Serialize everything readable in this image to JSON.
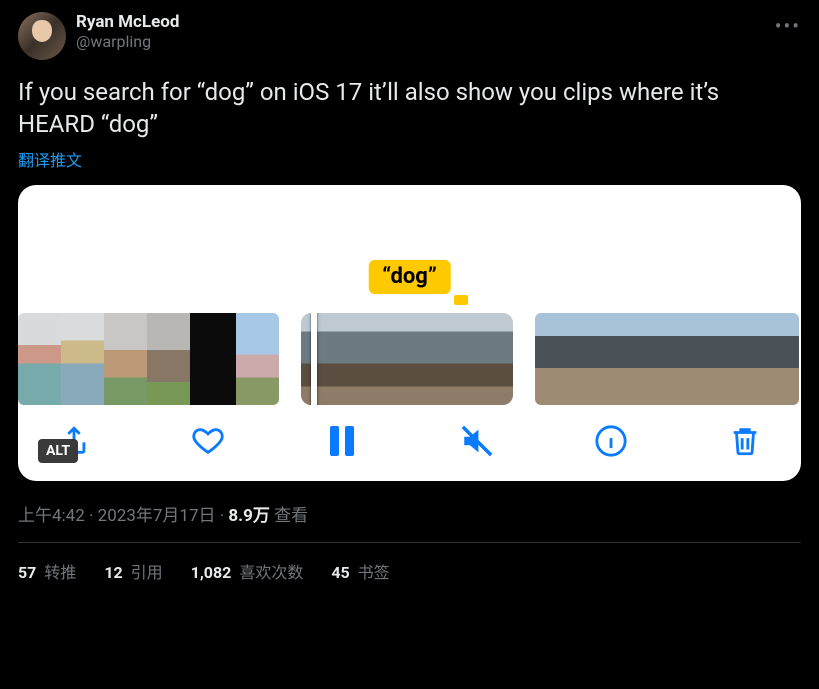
{
  "author": {
    "display_name": "Ryan McLeod",
    "handle": "@warpling"
  },
  "tweet_text": "If you search for “dog” on iOS 17 it’ll also show you clips where it’s HEARD “dog”",
  "translate_label": "翻译推文",
  "media": {
    "search_bubble": "“dog”",
    "alt_badge": "ALT",
    "control_icons": {
      "share": "share-icon",
      "like": "heart-icon",
      "pause": "pause-icon",
      "mute": "speaker-muted-icon",
      "info": "info-icon",
      "delete": "trash-icon"
    }
  },
  "meta": {
    "time": "上午4:42",
    "separator": " · ",
    "date": "2023年7月17日",
    "views_count": "8.9万",
    "views_label": " 查看"
  },
  "engagement": {
    "retweets_count": "57",
    "retweets_label": " 转推",
    "quotes_count": "12",
    "quotes_label": " 引用",
    "likes_count": "1,082",
    "likes_label": " 喜欢次数",
    "bookmarks_count": "45",
    "bookmarks_label": " 书签"
  }
}
